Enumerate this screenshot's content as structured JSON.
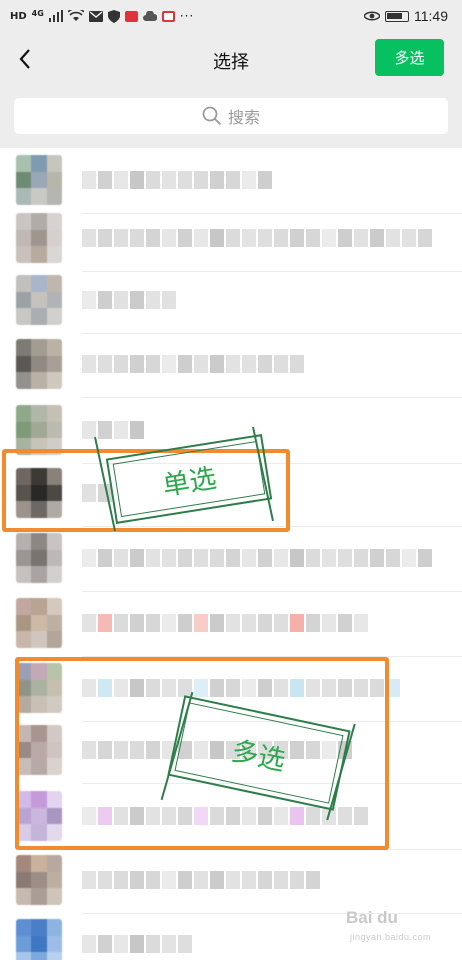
{
  "status_bar": {
    "network_label": "HD",
    "signal_label": "4G",
    "time": "11:49"
  },
  "nav": {
    "title": "选择",
    "multi_select_button": "多选"
  },
  "search": {
    "placeholder": "搜索"
  },
  "annotations": {
    "single_select": "单选",
    "multi_select": "多选",
    "highlight_color": "#f28a2e",
    "stamp_color": "#2ea84f"
  },
  "watermark": {
    "brand": "Bai du",
    "subtitle": "jingyan.baidu.com"
  },
  "colors": {
    "accent": "#07c160",
    "background": "#ededed"
  },
  "contacts": [
    {
      "avatar": [
        "#a9c0ae",
        "#7f9bb2",
        "#c7c6bd",
        "#6f8a72",
        "#9aa7b6",
        "#b7b6aa",
        "#aab9b6",
        "#c9c9c3",
        "#b6b6b1"
      ]
    },
    {
      "avatar": [
        "#cac5c3",
        "#b2aca7",
        "#d7d2cf",
        "#c0b8b2",
        "#9f978f",
        "#d6d0cc",
        "#c9c2bc",
        "#b8ab9e",
        "#d9d6d3"
      ]
    },
    {
      "avatar": [
        "#c2c0bd",
        "#a8b6c9",
        "#bfb7ae",
        "#9aa2a5",
        "#c6c3bf",
        "#b1b4b6",
        "#c9c7c2",
        "#a8aeb2",
        "#d1d0cc"
      ]
    },
    {
      "avatar": [
        "#7e7a74",
        "#a39c90",
        "#b9b2a5",
        "#5b5955",
        "#8f8a82",
        "#a8a096",
        "#93918c",
        "#b7b1a6",
        "#cfc8bc"
      ]
    },
    {
      "avatar": [
        "#8fa88a",
        "#b0b7a8",
        "#c5c0b4",
        "#7f9a78",
        "#a1a896",
        "#bcbab0",
        "#a8b29f",
        "#c8c4ba",
        "#d0cdc6"
      ]
    },
    {
      "avatar": [
        "#6f6660",
        "#3d3a36",
        "#8a817a",
        "#5a534d",
        "#2a2826",
        "#4c4844",
        "#9b938c",
        "#6d6863",
        "#b0aaa4"
      ]
    },
    {
      "avatar": [
        "#b5b0ad",
        "#8d8784",
        "#c8c4c1",
        "#9c9693",
        "#7a7471",
        "#bdb8b5",
        "#c6c1be",
        "#a9a4a1",
        "#d3cfcc"
      ]
    },
    {
      "avatar": [
        "#c1a7a0",
        "#b9a392",
        "#d5c8bd",
        "#a89684",
        "#cdb9a6",
        "#bdb0a3",
        "#c9b6ab",
        "#d0c6be",
        "#b2a59a"
      ]
    },
    {
      "avatar": [
        "#9b9fb3",
        "#c3a9b8",
        "#b7c4a9",
        "#8e9487",
        "#aab3a1",
        "#c4bfae",
        "#b3aaa0",
        "#c8c0b4",
        "#d0cbc2"
      ]
    },
    {
      "avatar": [
        "#c4b6b3",
        "#a89592",
        "#d2c8c4",
        "#9b8986",
        "#b9aaa6",
        "#cfc4bf",
        "#c8bcb8",
        "#b7aaa6",
        "#d9d2ce"
      ]
    },
    {
      "avatar": [
        "#d2b9e6",
        "#c49ad9",
        "#e2d3ee",
        "#b9a4d2",
        "#cbb7dd",
        "#a997c2",
        "#d8cbe5",
        "#c4b5d8",
        "#e3d9ec"
      ]
    },
    {
      "avatar": [
        "#a5887c",
        "#c8b29c",
        "#b7a9a0",
        "#8a7a74",
        "#9c8e86",
        "#bdaea2",
        "#c6bab0",
        "#aa9d95",
        "#cec4ba"
      ]
    },
    {
      "avatar": [
        "#5e8fd1",
        "#4a7fc8",
        "#8cb3e2",
        "#6c9dd8",
        "#3f78c2",
        "#9bbde6",
        "#a6c6ea",
        "#7ea9dd",
        "#b7d0ee"
      ]
    }
  ]
}
